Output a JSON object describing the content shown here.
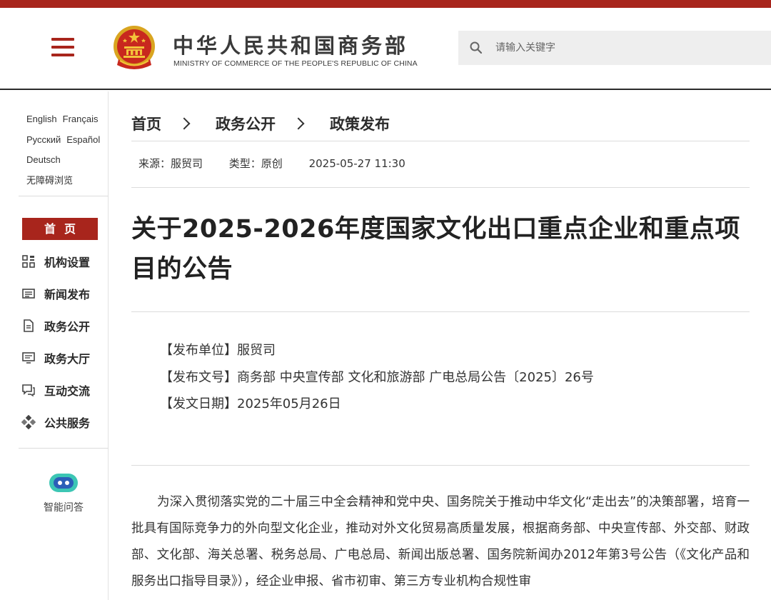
{
  "header": {
    "site_title_cn": "中华人民共和国商务部",
    "site_title_en": "MINISTRY OF COMMERCE OF THE PEOPLE'S REPUBLIC OF CHINA",
    "search_placeholder": "请输入关键字",
    "accent_color": "#a8251c"
  },
  "sidebar": {
    "languages": [
      "English",
      "Français",
      "Русский",
      "Español",
      "Deutsch"
    ],
    "accessibility": "无障碍浏览",
    "home": "首页",
    "nav": [
      {
        "label": "机构设置",
        "icon": "org-grid-icon"
      },
      {
        "label": "新闻发布",
        "icon": "newspaper-icon"
      },
      {
        "label": "政务公开",
        "icon": "document-icon"
      },
      {
        "label": "政务大厅",
        "icon": "monitor-icon"
      },
      {
        "label": "互动交流",
        "icon": "chat-icon"
      },
      {
        "label": "公共服务",
        "icon": "service-diamond-icon"
      }
    ],
    "ai_label": "智能问答"
  },
  "breadcrumb": [
    "首页",
    "政务公开",
    "政策发布"
  ],
  "meta": {
    "source": "来源：服贸司",
    "type": "类型：原创",
    "datetime": "2025-05-27 11:30"
  },
  "article": {
    "title": "关于2025-2026年度国家文化出口重点企业和重点项目的公告",
    "issuer": "【发布单位】服贸司",
    "doc_number": "【发布文号】商务部 中央宣传部 文化和旅游部 广电总局公告〔2025〕26号",
    "issue_date": "【发文日期】2025年05月26日",
    "body": "为深入贯彻落实党的二十届三中全会精神和党中央、国务院关于推动中华文化“走出去”的决策部署，培育一批具有国际竞争力的外向型文化企业，推动对外文化贸易高质量发展，根据商务部、中央宣传部、外交部、财政部、文化部、海关总署、税务总局、广电总局、新闻出版总署、国务院新闻办2012年第3号公告（《文化产品和服务出口指导目录》），经企业申报、省市初审、第三方专业机构合规性审"
  }
}
